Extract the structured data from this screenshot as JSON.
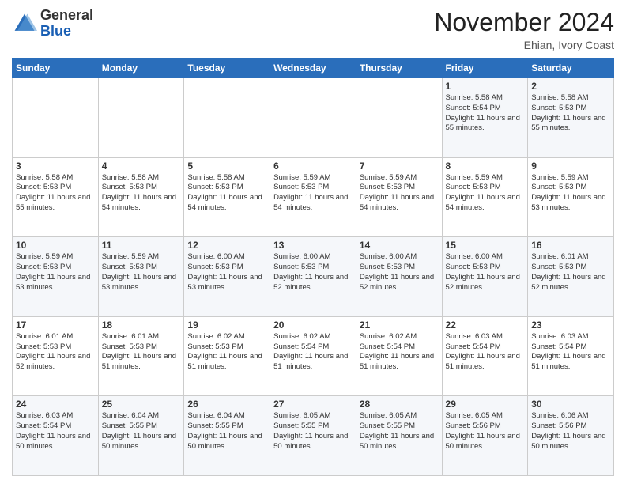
{
  "header": {
    "logo_line1": "General",
    "logo_line2": "Blue",
    "month": "November 2024",
    "location": "Ehian, Ivory Coast"
  },
  "weekdays": [
    "Sunday",
    "Monday",
    "Tuesday",
    "Wednesday",
    "Thursday",
    "Friday",
    "Saturday"
  ],
  "weeks": [
    [
      {
        "day": "",
        "text": ""
      },
      {
        "day": "",
        "text": ""
      },
      {
        "day": "",
        "text": ""
      },
      {
        "day": "",
        "text": ""
      },
      {
        "day": "",
        "text": ""
      },
      {
        "day": "1",
        "text": "Sunrise: 5:58 AM\nSunset: 5:54 PM\nDaylight: 11 hours and 55 minutes."
      },
      {
        "day": "2",
        "text": "Sunrise: 5:58 AM\nSunset: 5:53 PM\nDaylight: 11 hours and 55 minutes."
      }
    ],
    [
      {
        "day": "3",
        "text": "Sunrise: 5:58 AM\nSunset: 5:53 PM\nDaylight: 11 hours and 55 minutes."
      },
      {
        "day": "4",
        "text": "Sunrise: 5:58 AM\nSunset: 5:53 PM\nDaylight: 11 hours and 54 minutes."
      },
      {
        "day": "5",
        "text": "Sunrise: 5:58 AM\nSunset: 5:53 PM\nDaylight: 11 hours and 54 minutes."
      },
      {
        "day": "6",
        "text": "Sunrise: 5:59 AM\nSunset: 5:53 PM\nDaylight: 11 hours and 54 minutes."
      },
      {
        "day": "7",
        "text": "Sunrise: 5:59 AM\nSunset: 5:53 PM\nDaylight: 11 hours and 54 minutes."
      },
      {
        "day": "8",
        "text": "Sunrise: 5:59 AM\nSunset: 5:53 PM\nDaylight: 11 hours and 54 minutes."
      },
      {
        "day": "9",
        "text": "Sunrise: 5:59 AM\nSunset: 5:53 PM\nDaylight: 11 hours and 53 minutes."
      }
    ],
    [
      {
        "day": "10",
        "text": "Sunrise: 5:59 AM\nSunset: 5:53 PM\nDaylight: 11 hours and 53 minutes."
      },
      {
        "day": "11",
        "text": "Sunrise: 5:59 AM\nSunset: 5:53 PM\nDaylight: 11 hours and 53 minutes."
      },
      {
        "day": "12",
        "text": "Sunrise: 6:00 AM\nSunset: 5:53 PM\nDaylight: 11 hours and 53 minutes."
      },
      {
        "day": "13",
        "text": "Sunrise: 6:00 AM\nSunset: 5:53 PM\nDaylight: 11 hours and 52 minutes."
      },
      {
        "day": "14",
        "text": "Sunrise: 6:00 AM\nSunset: 5:53 PM\nDaylight: 11 hours and 52 minutes."
      },
      {
        "day": "15",
        "text": "Sunrise: 6:00 AM\nSunset: 5:53 PM\nDaylight: 11 hours and 52 minutes."
      },
      {
        "day": "16",
        "text": "Sunrise: 6:01 AM\nSunset: 5:53 PM\nDaylight: 11 hours and 52 minutes."
      }
    ],
    [
      {
        "day": "17",
        "text": "Sunrise: 6:01 AM\nSunset: 5:53 PM\nDaylight: 11 hours and 52 minutes."
      },
      {
        "day": "18",
        "text": "Sunrise: 6:01 AM\nSunset: 5:53 PM\nDaylight: 11 hours and 51 minutes."
      },
      {
        "day": "19",
        "text": "Sunrise: 6:02 AM\nSunset: 5:53 PM\nDaylight: 11 hours and 51 minutes."
      },
      {
        "day": "20",
        "text": "Sunrise: 6:02 AM\nSunset: 5:54 PM\nDaylight: 11 hours and 51 minutes."
      },
      {
        "day": "21",
        "text": "Sunrise: 6:02 AM\nSunset: 5:54 PM\nDaylight: 11 hours and 51 minutes."
      },
      {
        "day": "22",
        "text": "Sunrise: 6:03 AM\nSunset: 5:54 PM\nDaylight: 11 hours and 51 minutes."
      },
      {
        "day": "23",
        "text": "Sunrise: 6:03 AM\nSunset: 5:54 PM\nDaylight: 11 hours and 51 minutes."
      }
    ],
    [
      {
        "day": "24",
        "text": "Sunrise: 6:03 AM\nSunset: 5:54 PM\nDaylight: 11 hours and 50 minutes."
      },
      {
        "day": "25",
        "text": "Sunrise: 6:04 AM\nSunset: 5:55 PM\nDaylight: 11 hours and 50 minutes."
      },
      {
        "day": "26",
        "text": "Sunrise: 6:04 AM\nSunset: 5:55 PM\nDaylight: 11 hours and 50 minutes."
      },
      {
        "day": "27",
        "text": "Sunrise: 6:05 AM\nSunset: 5:55 PM\nDaylight: 11 hours and 50 minutes."
      },
      {
        "day": "28",
        "text": "Sunrise: 6:05 AM\nSunset: 5:55 PM\nDaylight: 11 hours and 50 minutes."
      },
      {
        "day": "29",
        "text": "Sunrise: 6:05 AM\nSunset: 5:56 PM\nDaylight: 11 hours and 50 minutes."
      },
      {
        "day": "30",
        "text": "Sunrise: 6:06 AM\nSunset: 5:56 PM\nDaylight: 11 hours and 50 minutes."
      }
    ]
  ]
}
